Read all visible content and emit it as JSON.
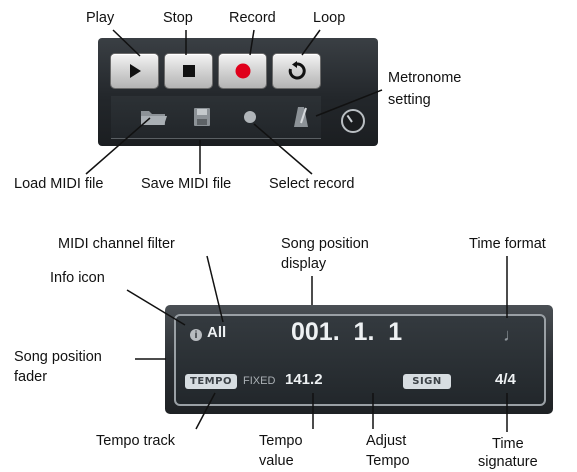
{
  "transport": {
    "callouts": {
      "play": "Play",
      "stop": "Stop",
      "record": "Record",
      "loop": "Loop",
      "metronome_line1": "Metronome",
      "metronome_line2": "setting",
      "load_midi": "Load MIDI file",
      "save_midi": "Save MIDI file",
      "select_record": "Select record"
    },
    "colors": {
      "record": "#e0001b"
    },
    "icons": [
      "play-icon",
      "stop-icon",
      "record-icon",
      "loop-icon",
      "folder-icon",
      "floppy-disk-icon",
      "record-select-icon",
      "metronome-icon",
      "knob-icon"
    ]
  },
  "display": {
    "midi_channel": "All",
    "position": "001.  1.  1",
    "time_format_glyph": "♩",
    "tempo_badge": "TEMPO",
    "tempo_mode": "FIXED",
    "tempo_value": "141.2",
    "sign_badge": "SIGN",
    "time_signature": "4/4",
    "callouts": {
      "midi_channel_filter": "MIDI channel filter",
      "song_position_display_line1": "Song position",
      "song_position_display_line2": "display",
      "time_format": "Time format",
      "info_icon": "Info icon",
      "song_position_fader_line1": "Song position",
      "song_position_fader_line2": "fader",
      "tempo_track": "Tempo track",
      "tempo_value_line1": "Tempo",
      "tempo_value_line2": "value",
      "adjust_tempo_line1": "Adjust",
      "adjust_tempo_line2": "Tempo",
      "time_signature_line1": "Time",
      "time_signature_line2": "signature"
    }
  }
}
